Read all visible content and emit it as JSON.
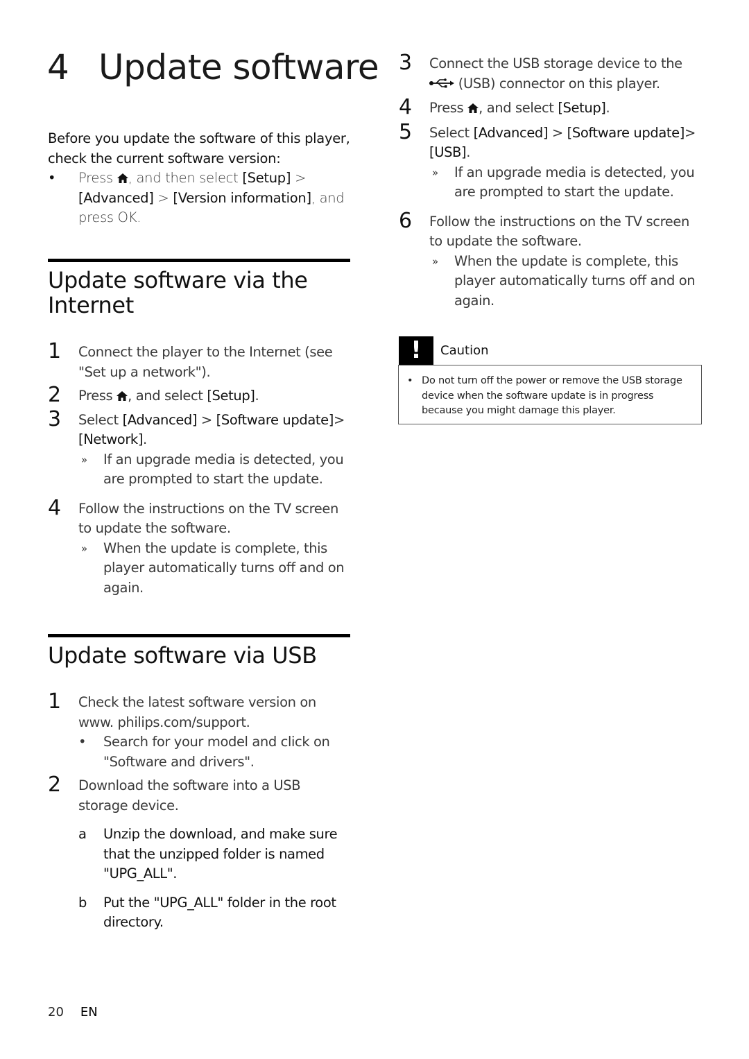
{
  "chapter": {
    "number": "4",
    "title": "Update software"
  },
  "intro": {
    "text": "Before you update the software of this player, check the current software version:",
    "bullet": {
      "marker": "•",
      "pre": "Press ",
      "icon": "home-icon",
      "mid": ", and then select ",
      "menu1": "[Setup]",
      "sep1": " > ",
      "menu2": "[Advanced]",
      "sep2": " > ",
      "menu3": "[Version information]",
      "post": ", and press OK."
    }
  },
  "section_internet": {
    "title": "Update software via the Internet",
    "steps": [
      {
        "num": "1",
        "text": "Connect the player to the Internet (see \"Set up a network\")."
      },
      {
        "num": "2",
        "pre": "Press ",
        "icon": "home-icon",
        "mid": ", and select ",
        "menu1": "[Setup]",
        "post": "."
      },
      {
        "num": "3",
        "pre": "Select ",
        "menu1": "[Advanced]",
        "sep1": " > ",
        "menu2": "[Software update]",
        "sep2": "> ",
        "menu3": "[Network]",
        "post": ".",
        "result": {
          "marker": "»",
          "text": "If an upgrade media is detected, you are prompted to start the update."
        }
      },
      {
        "num": "4",
        "text": "Follow the instructions on the TV screen to update the software.",
        "result": {
          "marker": "»",
          "text": "When the update is complete, this player automatically turns off and on again."
        }
      }
    ]
  },
  "section_usb": {
    "title": "Update software via USB",
    "steps": [
      {
        "num": "1",
        "text": "Check the latest software version on www. philips.com/support.",
        "sub": {
          "marker": "•",
          "text": "Search for your model and click on \"Software and drivers\"."
        }
      },
      {
        "num": "2",
        "text": "Download the software into a USB storage device.",
        "substeps": [
          {
            "marker": "a",
            "text": "Unzip the download, and make sure that the unzipped folder is named \"UPG_ALL\"."
          },
          {
            "marker": "b",
            "text": "Put the \"UPG_ALL\" folder in the root directory."
          }
        ]
      },
      {
        "num": "3",
        "pre": "Connect the USB storage device to the ",
        "icon": "usb-icon",
        "post": " (USB) connector on this player."
      },
      {
        "num": "4",
        "pre": "Press ",
        "icon": "home-icon",
        "mid": ", and select ",
        "menu1": "[Setup]",
        "post": "."
      },
      {
        "num": "5",
        "pre": "Select ",
        "menu1": "[Advanced]",
        "sep1": " > ",
        "menu2": "[Software update]",
        "sep2": "> ",
        "menu3": "[USB]",
        "post": ".",
        "result": {
          "marker": "»",
          "text": "If an upgrade media is detected, you are prompted to start the update."
        }
      },
      {
        "num": "6",
        "text": "Follow the instructions on the TV screen to update the software.",
        "result": {
          "marker": "»",
          "text": "When the update is complete, this player automatically turns off and on again."
        }
      }
    ]
  },
  "caution": {
    "badge": "!",
    "label": "Caution",
    "marker": "•",
    "text": "Do not turn off the power or remove the USB storage device when the software update is in progress because you might damage this player."
  },
  "footer": {
    "page_number": "20",
    "language": "EN"
  }
}
